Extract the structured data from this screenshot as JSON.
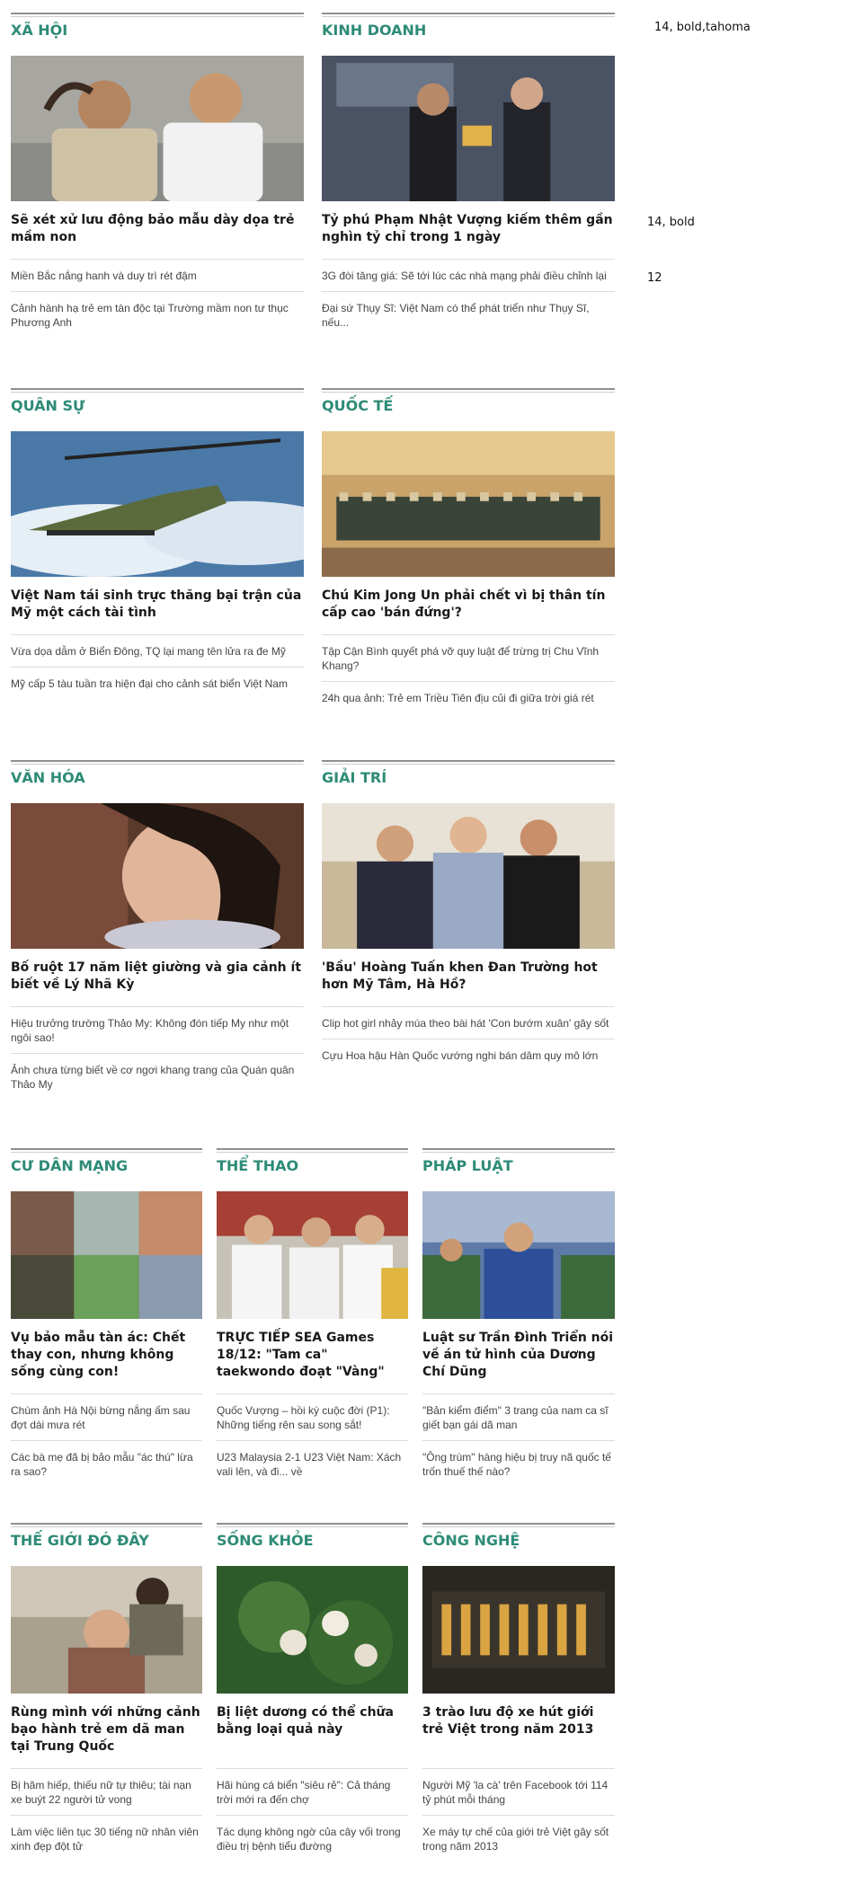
{
  "notes": {
    "n1": "14, bold,tahoma",
    "n2": "14, bold",
    "n3": "12"
  },
  "sections": [
    {
      "key": "xahoi",
      "title": "XÃ HỘI",
      "headline": "Sẽ xét xử lưu động bảo mẫu dày dọa trẻ mầm non",
      "links": [
        "Miền Bắc nắng hanh và duy trì rét đậm",
        "Cảnh hành hạ trẻ em tàn độc tại Trường mầm non tư thục Phương Anh"
      ]
    },
    {
      "key": "kinhdoanh",
      "title": "KINH DOANH",
      "headline": "Tỷ phú Phạm Nhật Vượng kiếm thêm gần nghìn tỷ chỉ trong 1 ngày",
      "links": [
        "3G đòi tăng giá: Sẽ tới lúc các nhà mạng phải điều chỉnh lại",
        "Đại sứ Thụy Sĩ: Việt Nam có thể phát triển như Thụy Sĩ, nếu..."
      ]
    },
    {
      "key": "quansu",
      "title": "QUÂN SỰ",
      "headline": "Việt Nam tái sinh trực thăng bại trận của Mỹ một cách tài tình",
      "links": [
        "Vừa dọa dẫm ở Biển Đông, TQ lại mang tên lửa ra đe Mỹ",
        "Mỹ cấp 5 tàu tuần tra hiện đại cho cảnh sát biển Việt Nam"
      ]
    },
    {
      "key": "quocte",
      "title": "QUỐC TẾ",
      "headline": "Chú Kim Jong Un phải chết vì bị thân tín cấp cao 'bán đứng'?",
      "links": [
        "Tập Cận Bình quyết phá vỡ quy luật để trừng trị Chu Vĩnh Khang?",
        "24h qua ảnh: Trẻ em Triều Tiên địu củi đi giữa trời giá rét"
      ]
    },
    {
      "key": "vanhoa",
      "title": "VĂN HÓA",
      "headline": "Bố ruột 17 năm liệt giường và gia cảnh ít biết về Lý Nhã Kỳ",
      "links": [
        "Hiệu trưởng trường Thảo My: Không đón tiếp My như một ngôi sao!",
        "Ảnh chưa từng biết về cơ ngơi khang trang của Quán quân Thảo My"
      ]
    },
    {
      "key": "giaitri",
      "title": "GIẢI TRÍ",
      "headline": "'Bầu' Hoàng Tuấn khen Đan Trường hot hơn Mỹ Tâm, Hà Hồ?",
      "links": [
        "Clip hot girl nhảy múa theo bài hát 'Con bướm xuân' gây sốt",
        "Cựu Hoa hậu Hàn Quốc vướng nghi bán dâm quy mô lớn"
      ]
    },
    {
      "key": "cudanmang",
      "title": "CƯ DÂN MẠNG",
      "headline": "Vụ bảo mẫu tàn ác: Chết thay con, nhưng không sống cùng con!",
      "links": [
        "Chùm ảnh Hà Nội bừng nắng ấm sau đợt dài mưa rét",
        "Các bà mẹ đã bị bảo mẫu \"ác thú\" lừa ra sao?"
      ]
    },
    {
      "key": "thethao",
      "title": "THỂ THAO",
      "headline": "TRỰC TIẾP SEA Games 18/12: \"Tam ca\" taekwondo đoạt \"Vàng\"",
      "links": [
        "Quốc Vượng – hồi ký cuộc đời (P1): Những tiếng rên sau song sắt!",
        "U23 Malaysia 2-1 U23 Việt Nam: Xách vali lên, và đi... về"
      ]
    },
    {
      "key": "phapluat",
      "title": "PHÁP LUẬT",
      "headline": "Luật sư Trần Đình Triển nói về án tử hình của Dương Chí Dũng",
      "links": [
        "\"Bản kiểm điểm\" 3 trang của nam ca sĩ giết bạn gái dã man",
        "\"Ông trùm\" hàng hiệu bị truy nã quốc tế trốn thuế thế nào?"
      ]
    },
    {
      "key": "thegioi",
      "title": "THẾ GIỚI ĐÓ ĐÂY",
      "headline": "Rùng mình với những cảnh bạo hành trẻ em dã man tại Trung Quốc",
      "links": [
        "Bị hăm hiếp, thiếu nữ tự thiêu; tài nạn xe buýt 22 người tử vong",
        "Làm việc liên tục 30 tiếng nữ nhân viên xinh đẹp đột tử"
      ]
    },
    {
      "key": "songkhoe",
      "title": "SỐNG KHỎE",
      "headline": "Bị liệt dương có thể chữa bằng loại quả này",
      "links": [
        "Hãi hùng cá biển \"siêu rẻ\": Cả tháng trời mới ra đến chợ",
        "Tác dụng không ngờ của cây vối trong điều trị bệnh tiểu đường"
      ]
    },
    {
      "key": "congnghe",
      "title": "CÔNG NGHỆ",
      "headline": "3 trào lưu độ xe hút giới trẻ Việt trong năm 2013",
      "links": [
        "Người Mỹ 'la cà' trên Facebook tới 114 tỷ phút mỗi tháng",
        "Xe máy tự chế của giới trẻ Việt gây sốt trong năm 2013"
      ]
    }
  ]
}
